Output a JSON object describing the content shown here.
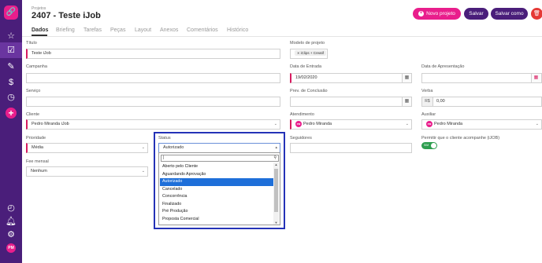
{
  "breadcrumb": "Projetos",
  "title": "2407 - Teste iJob",
  "actions": {
    "new_project": "Novo projeto",
    "save": "Salvar",
    "save_as": "Salvar como"
  },
  "tabs": [
    "Dados",
    "Briefing",
    "Tarefas",
    "Peças",
    "Layout",
    "Anexos",
    "Comentários",
    "Histórico"
  ],
  "form": {
    "titulo": {
      "label": "Título",
      "value": "Teste iJob"
    },
    "modelo": {
      "label": "Modelo de projeto",
      "value": "iClips + Creatif"
    },
    "campanha": {
      "label": "Campanha",
      "value": ""
    },
    "data_entrada": {
      "label": "Data de Entrada",
      "value": "19/02/2020"
    },
    "data_apresentacao": {
      "label": "Data de Apresentação",
      "value": ""
    },
    "servico": {
      "label": "Serviço",
      "value": ""
    },
    "prev_conclusao": {
      "label": "Prev. de Conclusão",
      "value": ""
    },
    "verba": {
      "label": "Verba",
      "prefix": "R$",
      "value": "0,00"
    },
    "cliente": {
      "label": "Cliente",
      "value": "Pedro Miranda iJob"
    },
    "atendimento": {
      "label": "Atendimento",
      "value": "Pedro Miranda",
      "avatar": "PM"
    },
    "auxiliar": {
      "label": "Auxiliar",
      "value": "Pedro Miranda",
      "avatar": "PM"
    },
    "prioridade": {
      "label": "Prioridade",
      "value": "Média"
    },
    "status": {
      "label": "Status",
      "value": "Autorizado"
    },
    "seguidores": {
      "label": "Seguidores",
      "value": ""
    },
    "permitir": {
      "label": "Permitir que o cliente acompanhe (iJOB)",
      "toggle": "SIM"
    },
    "fee": {
      "label": "Fee mensal",
      "value": "Nenhum"
    }
  },
  "status_options": [
    "Aberto pelo Cliente",
    "Aguardando Aprovação",
    "Autorizado",
    "Cancelado",
    "Concorrência",
    "Finalizado",
    "Pré Produção",
    "Proposta Comercial"
  ],
  "status_selected": "Autorizado",
  "user_initials": "PM",
  "colors": {
    "sidebar": "#4a1e7a",
    "accent": "#e91e8c",
    "danger": "#e53935",
    "selection": "#1e6fd9",
    "highlight": "#2432b7"
  }
}
